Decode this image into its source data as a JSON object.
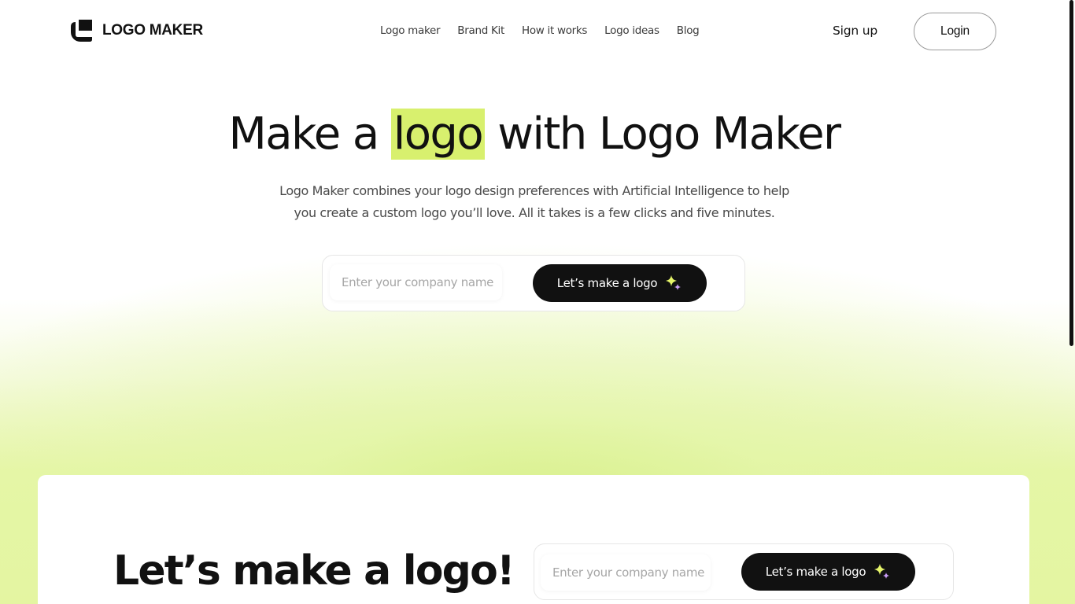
{
  "brand": {
    "name": "LOGO MAKER",
    "accent": "#d8f06e"
  },
  "nav": {
    "items": [
      {
        "label": "Logo maker"
      },
      {
        "label": "Brand Kit"
      },
      {
        "label": "How it works"
      },
      {
        "label": "Logo ideas"
      },
      {
        "label": "Blog"
      }
    ]
  },
  "auth": {
    "signup_label": "Sign up",
    "login_label": "Login"
  },
  "hero": {
    "title_before": "Make a ",
    "title_highlight": "logo",
    "title_after": " with Logo Maker",
    "subtitle": "Logo Maker combines your logo design preferences with Artificial Intelligence to help you create a custom logo you’ll love. All it takes is a few clicks and five minutes.",
    "input_placeholder": "Enter your company name",
    "input_value": "",
    "cta_label": "Let’s make a logo",
    "cta_icon": "sparkle-icon"
  },
  "card": {
    "title": "Let’s make a logo!",
    "input_placeholder": "Enter your company name",
    "input_value": "",
    "cta_label": "Let’s make a logo",
    "cta_icon": "sparkle-icon"
  },
  "colors": {
    "button": "#111111",
    "sparkle_yellow": "#e6f56a",
    "sparkle_purple": "#c79bf5"
  }
}
